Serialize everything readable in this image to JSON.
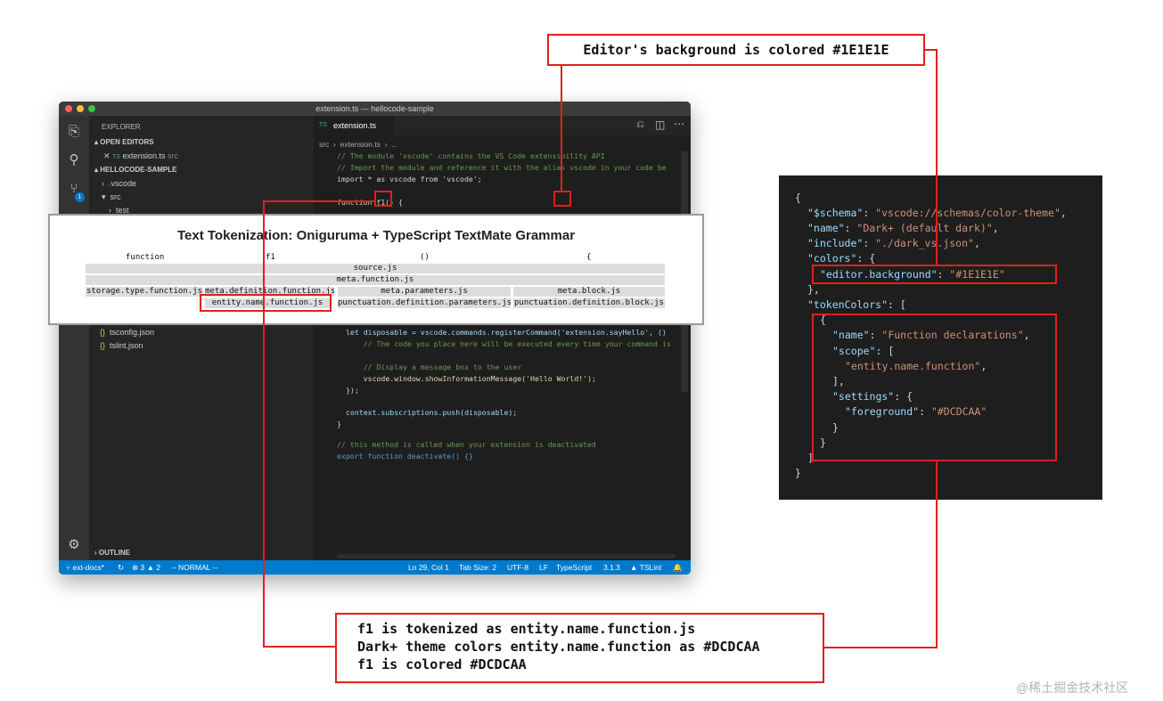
{
  "callouts": {
    "top": "Editor's background is colored #1E1E1E",
    "bottom": [
      "f1 is tokenized as entity.name.function.js",
      "Dark+ theme colors entity.name.function as #DCDCAA",
      "f1 is colored #DCDCAA"
    ]
  },
  "vscode": {
    "window_title": "extension.ts — hellocode-sample",
    "sidebar": {
      "title": "EXPLORER",
      "open_editors": "OPEN EDITORS",
      "open_file": "extension.ts",
      "open_file_dir": "src",
      "project": "HELLOCODE-SAMPLE",
      "items": [
        ".vscode",
        "src",
        "test"
      ],
      "lower_items": [
        "tsconfig.json",
        "tslint.json"
      ],
      "outline": "OUTLINE",
      "badge": "1"
    },
    "tab": "extension.ts",
    "breadcrumb": "src  ›  extension.ts  ›  ...",
    "code": [
      "// The module 'vscode' contains the VS Code extensibility API",
      "// Import the module and reference it with the alias vscode in your code be",
      "import * as vscode from 'vscode';",
      "",
      "function f1() {",
      "let disposable = vscode.commands.registerCommand('extension.sayHello', ()",
      "    // The code you place here will be executed every time your command is",
      "",
      "    // Display a message box to the user",
      "    vscode.window.showInformationMessage('Hello World!');",
      "});",
      "",
      "context.subscriptions.push(disposable);",
      "}",
      "",
      "// this method is called when your extension is deactivated",
      "export function deactivate() {}"
    ],
    "status": {
      "branch": "ext-docs*",
      "errors": "3",
      "warnings": "2",
      "mode": "-- NORMAL --",
      "position": "Ln 29, Col 1",
      "tab_size": "Tab Size: 2",
      "encoding": "UTF-8",
      "eol": "LF",
      "language": "TypeScript",
      "version": "3.1.3",
      "linter": "TSLint"
    }
  },
  "tokenization": {
    "title": "Text Tokenization: Oniguruma + TypeScript TextMate Grammar",
    "tokens": [
      "function",
      "f1",
      "()",
      "{"
    ],
    "scopes": {
      "row1": "source.js",
      "row2": "meta.function.js",
      "row3": [
        "storage.type.function.js",
        "meta.definition.function.js",
        "meta.parameters.js",
        "meta.block.js"
      ],
      "row4": [
        "entity.name.function.js",
        "punctuation.definition.parameters.js",
        "punctuation.definition.block.js"
      ]
    }
  },
  "theme_json": {
    "schema_key": "\"$schema\"",
    "schema_val": "\"vscode://schemas/color-theme\"",
    "name_key": "\"name\"",
    "name_val": "\"Dark+ (default dark)\"",
    "include_key": "\"include\"",
    "include_val": "\"./dark_vs.json\"",
    "colors_key": "\"colors\"",
    "editor_bg_key": "\"editor.background\"",
    "editor_bg_val": "\"#1E1E1E\"",
    "token_colors_key": "\"tokenColors\"",
    "tc_name_key": "\"name\"",
    "tc_name_val": "\"Function declarations\"",
    "scope_key": "\"scope\"",
    "scope_val": "\"entity.name.function\"",
    "settings_key": "\"settings\"",
    "foreground_key": "\"foreground\"",
    "foreground_val": "\"#DCDCAA\""
  },
  "watermark": "@稀土掘金技术社区",
  "colors": {
    "callout_red": "#e0201d",
    "editor_bg": "#1E1E1E",
    "function_color": "#DCDCAA"
  }
}
